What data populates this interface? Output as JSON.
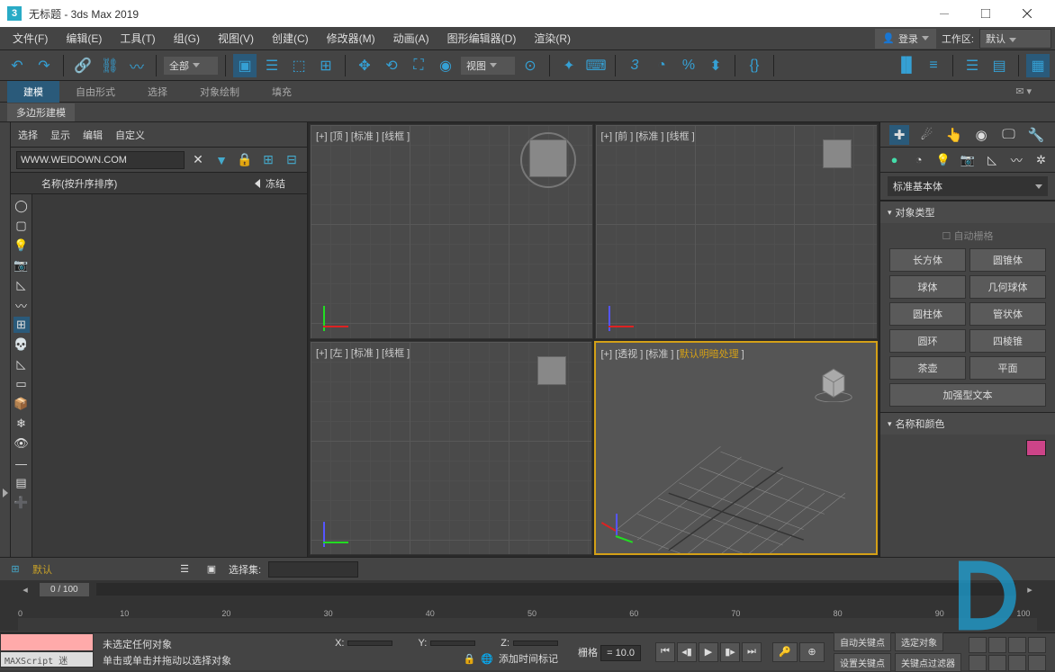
{
  "title": "无标题 - 3ds Max 2019",
  "menu": [
    "文件(F)",
    "编辑(E)",
    "工具(T)",
    "组(G)",
    "视图(V)",
    "创建(C)",
    "修改器(M)",
    "动画(A)",
    "图形编辑器(D)",
    "渲染(R)"
  ],
  "login": "登录",
  "workspace_label": "工作区:",
  "workspace_value": "默认",
  "toolbar_select_all": "全部",
  "toolbar_select_view": "视图",
  "ribbon_tabs": [
    "建模",
    "自由形式",
    "选择",
    "对象绘制",
    "填充"
  ],
  "ribbon_sub": "多边形建模",
  "explorer": {
    "tabs": [
      "选择",
      "显示",
      "编辑",
      "自定义"
    ],
    "search_value": "WWW.WEIDOWN.COM",
    "col_name": "名称(按升序排序)",
    "col_freeze": "冻结"
  },
  "viewports": {
    "top": "[+] [顶 ] [标准 ] [线框 ]",
    "front": "[+] [前 ] [标准 ] [线框 ]",
    "left": "[+] [左 ] [标准 ] [线框 ]",
    "persp_a": "[+]  [透视 ]  [标准 ] [",
    "persp_b": "默认明暗处理",
    "persp_c": " ]"
  },
  "cmd": {
    "droplist": "标准基本体",
    "roll_objtype": "对象类型",
    "autogrid": "自动栅格",
    "objects": [
      "长方体",
      "圆锥体",
      "球体",
      "几何球体",
      "圆柱体",
      "管状体",
      "圆环",
      "四棱锥",
      "茶壶",
      "平面",
      "加强型文本"
    ],
    "roll_namecolor": "名称和颜色",
    "color": "#cc4488"
  },
  "bottom": {
    "default": "默认",
    "selset_label": "选择集:"
  },
  "time": {
    "slider": "0  /  100",
    "ticks": [
      "0",
      "10",
      "20",
      "30",
      "40",
      "50",
      "60",
      "70",
      "80",
      "90",
      "100"
    ]
  },
  "status": {
    "msg1": "未选定任何对象",
    "msg2": "单击或单击并拖动以选择对象",
    "x_label": "X:",
    "y_label": "Y:",
    "z_label": "Z:",
    "grid_label": "栅格",
    "grid_val": "= 10.0",
    "add_time": "添加时间标记",
    "maxscript": "MAXScript 迷",
    "autokey": "自动关键点",
    "selobj": "选定对象",
    "setkey": "设置关键点",
    "keyfilter": "关键点过滤器"
  }
}
